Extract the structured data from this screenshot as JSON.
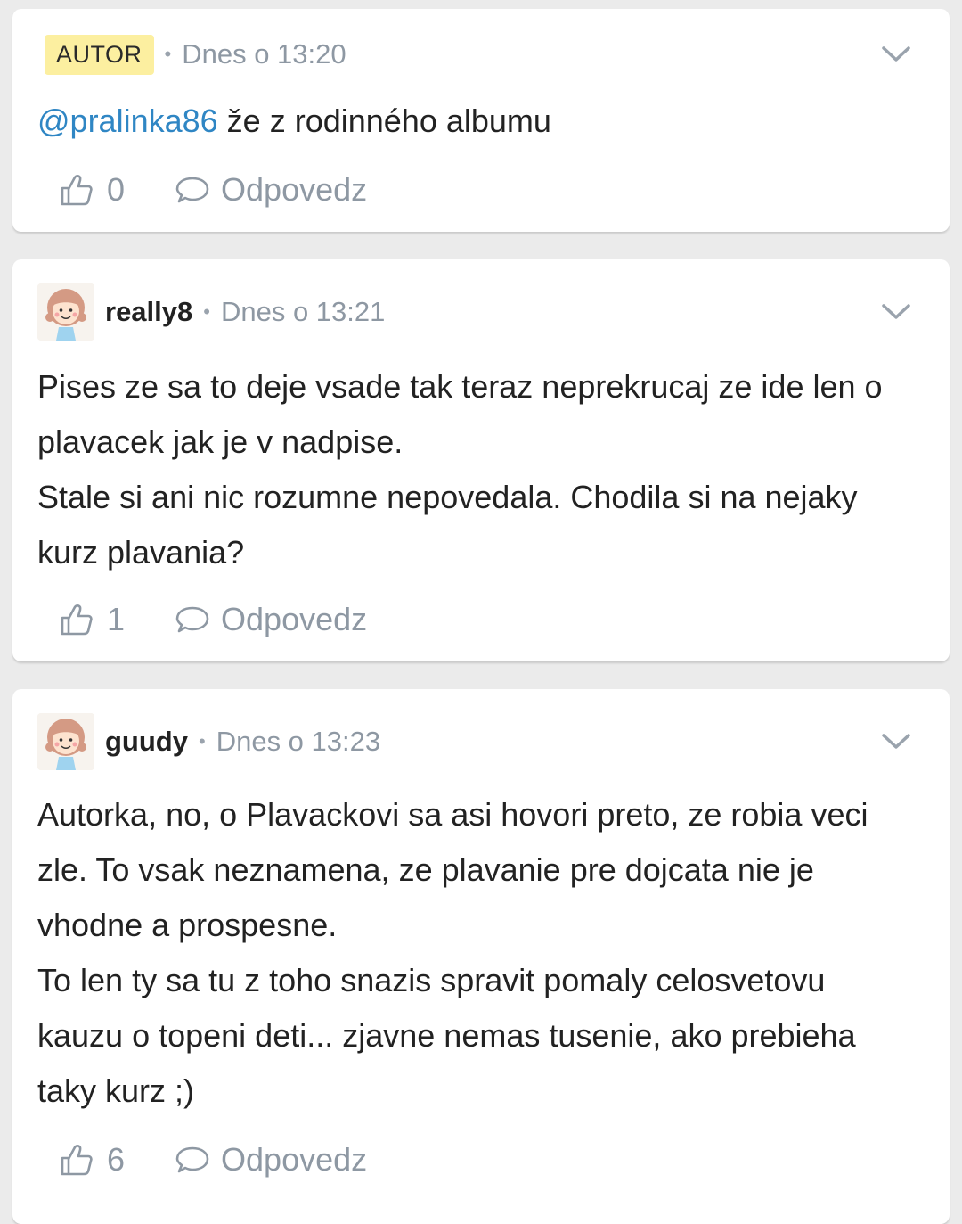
{
  "comments": [
    {
      "badge": "AUTOR",
      "separator": "•",
      "time": "Dnes o 13:20",
      "mention": "@pralinka86",
      "text": " že z rodinného albumu",
      "likes": "0",
      "reply_label": "Odpovedz"
    },
    {
      "username": "really8",
      "separator": "•",
      "time": "Dnes o 13:21",
      "paragraphs": [
        "Pises ze sa to deje vsade tak teraz neprekrucaj ze ide len o plavacek jak je v nadpise.",
        "Stale si ani nic rozumne nepovedala. Chodila si na nejaky kurz plavania?"
      ],
      "likes": "1",
      "reply_label": "Odpovedz"
    },
    {
      "username": "guudy",
      "separator": "•",
      "time": "Dnes o 13:23",
      "paragraphs": [
        "Autorka, no, o Plavackovi sa asi hovori preto, ze robia veci zle. To vsak neznamena, ze plavanie pre dojcata nie je vhodne a prospesne.",
        "To len ty sa tu z toho snazis spravit pomaly celosvetovu kauzu o topeni deti... zjavne nemas tusenie, ako prebieha taky kurz ;)"
      ],
      "likes": "6",
      "reply_label": "Odpovedz"
    }
  ],
  "icons": {
    "like": "thumbs-up-outline",
    "reply": "speech-bubble-outline",
    "menu": "chevron-down",
    "avatar": "cartoon-girl-avatar"
  },
  "colors": {
    "background": "#ebebeb",
    "card": "#ffffff",
    "author_badge": "#fcefa0",
    "mention": "#2f86c4",
    "muted": "#8e98a3"
  }
}
